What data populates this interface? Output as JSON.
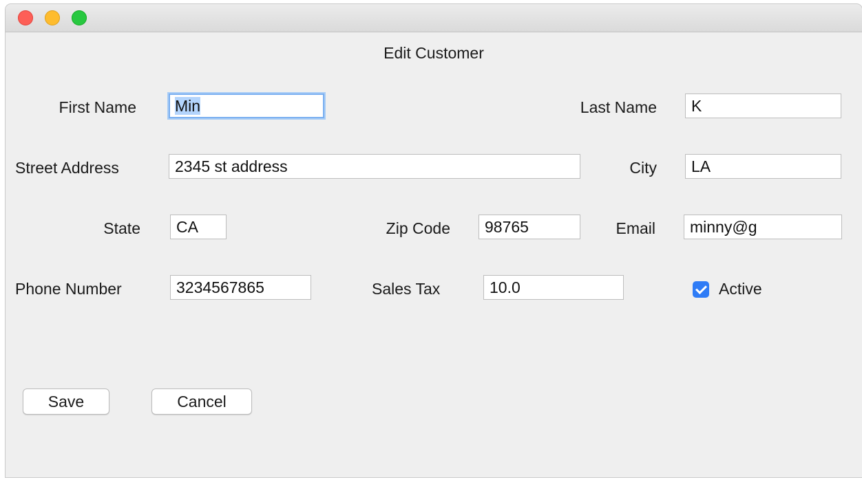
{
  "window": {
    "title": "Edit Customer"
  },
  "form": {
    "first_name": {
      "label": "First Name",
      "value": "Min"
    },
    "last_name": {
      "label": "Last Name",
      "value": "K"
    },
    "street_address": {
      "label": "Street Address",
      "value": "2345 st address"
    },
    "city": {
      "label": "City",
      "value": "LA"
    },
    "state": {
      "label": "State",
      "value": "CA"
    },
    "zip_code": {
      "label": "Zip Code",
      "value": "98765"
    },
    "email": {
      "label": "Email",
      "value": "minny@g"
    },
    "phone_number": {
      "label": "Phone Number",
      "value": "3234567865"
    },
    "sales_tax": {
      "label": "Sales Tax",
      "value": "10.0"
    },
    "active": {
      "label": "Active",
      "checked": true
    }
  },
  "buttons": {
    "save": "Save",
    "cancel": "Cancel"
  },
  "colors": {
    "accent": "#2f7cf6",
    "focus_ring": "#7aaff0",
    "close": "#fd5f57",
    "minimize": "#febc2e",
    "zoom": "#28c840"
  }
}
